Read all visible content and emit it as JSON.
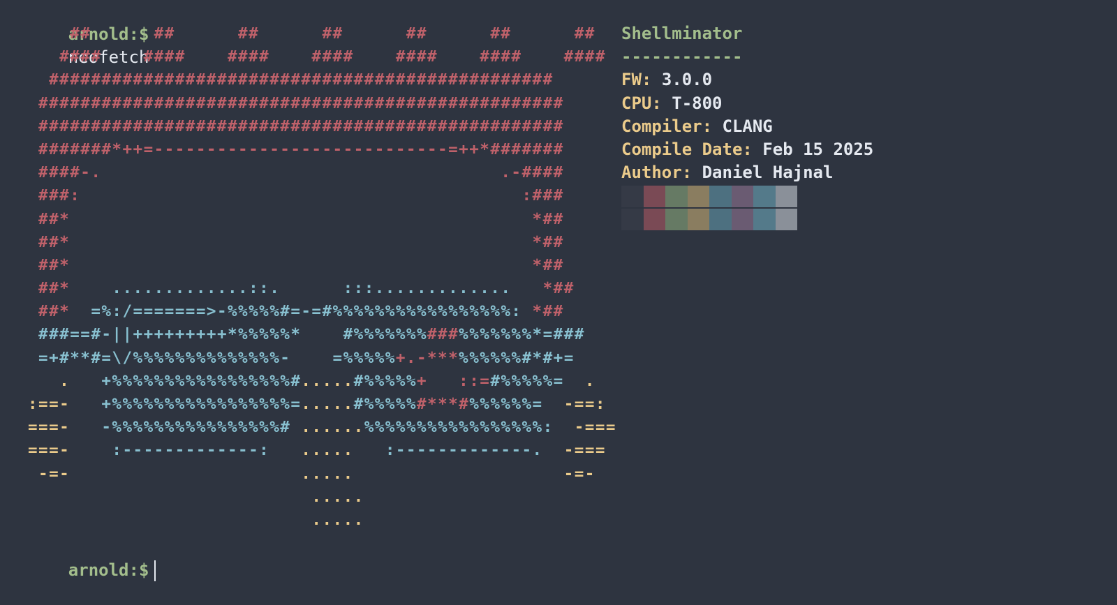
{
  "prompt": {
    "user": "arnold:$",
    "command": "neofetch",
    "next_user": "arnold:$"
  },
  "logo": {
    "lines": [
      [
        [
          "r",
          "    ##      ##      ##      ##      ##      ##      ##"
        ]
      ],
      [
        [
          "r",
          "   ####    ####    ####    ####    ####    ####    ####"
        ]
      ],
      [
        [
          "r",
          "  ################################################"
        ]
      ],
      [
        [
          "r",
          " ##################################################"
        ]
      ],
      [
        [
          "r",
          " ##################################################"
        ]
      ],
      [
        [
          "r",
          " #######*++=----------------------------=++*#######"
        ]
      ],
      [
        [
          "r",
          " ####-.                                      .-####"
        ]
      ],
      [
        [
          "r",
          " ###:                                          :###"
        ]
      ],
      [
        [
          "r",
          " ##*                                            *##"
        ]
      ],
      [
        [
          "r",
          " ##*                                            *##"
        ]
      ],
      [
        [
          "r",
          " ##*                                            *##"
        ]
      ],
      [
        [
          "r",
          " ##*"
        ],
        [
          "b",
          "    .............::.      :::............."
        ],
        [
          "r",
          "   *##"
        ]
      ],
      [
        [
          "r",
          " ##*"
        ],
        [
          "b",
          "  =%:/=======>-%%%%%#=-=#%%%%%%%%%%%%%%%%%: "
        ],
        [
          "r",
          "*##"
        ]
      ],
      [
        [
          "b",
          " ###==#-||+++++++++*%%%%%*    #%%%%%%%"
        ],
        [
          "r",
          "###"
        ],
        [
          "b",
          "%%%%%%%*=###"
        ]
      ],
      [
        [
          "b",
          " =+#**#=\\/%%%%%%%%%%%%%%-    =%%%%%"
        ],
        [
          "r",
          "+.-***"
        ],
        [
          "b",
          "%%%%%%#*#+="
        ]
      ],
      [
        [
          "y",
          "   .   "
        ],
        [
          "b",
          "+%%%%%%%%%%%%%%%%%#"
        ],
        [
          "y",
          "....."
        ],
        [
          "b",
          "#%%%%%"
        ],
        [
          "r",
          "+   ::="
        ],
        [
          "b",
          "#%%%%%="
        ],
        [
          "y",
          "  ."
        ]
      ],
      [
        [
          "y",
          ":==-   "
        ],
        [
          "b",
          "+%%%%%%%%%%%%%%%%%="
        ],
        [
          "y",
          "....."
        ],
        [
          "b",
          "#%%%%%"
        ],
        [
          "r",
          "#***#"
        ],
        [
          "b",
          "%%%%%%="
        ],
        [
          "y",
          "  -==:"
        ]
      ],
      [
        [
          "y",
          "===-   "
        ],
        [
          "b",
          "-%%%%%%%%%%%%%%%%#"
        ],
        [
          "y",
          " ......"
        ],
        [
          "b",
          "%%%%%%%%%%%%%%%%%: "
        ],
        [
          "y",
          " -==="
        ]
      ],
      [
        [
          "y",
          "===-    "
        ],
        [
          "b",
          ":-------------:"
        ],
        [
          "y",
          "   .....   "
        ],
        [
          "b",
          ":-------------."
        ],
        [
          "y",
          "  -==="
        ]
      ],
      [
        [
          "y",
          " -=-                      .....                    -=-"
        ]
      ],
      [
        [
          "y",
          "                           ....."
        ]
      ],
      [
        [
          "y",
          "                           ....."
        ]
      ]
    ]
  },
  "info": {
    "title": "Shellminator",
    "underline": "------------",
    "rows": [
      {
        "key": "FW:",
        "value": "3.0.0"
      },
      {
        "key": "CPU:",
        "value": "T-800"
      },
      {
        "key": "Compiler:",
        "value": "CLANG"
      },
      {
        "key": "Compile Date:",
        "value": "Feb 15 2025"
      },
      {
        "key": "Author:",
        "value": "Daniel Hajnal"
      }
    ]
  },
  "palette": {
    "row1": [
      "#353a46",
      "#7a4a55",
      "#667a64",
      "#8a7d60",
      "#4d7080",
      "#6a5b72",
      "#547a8a",
      "#8a9099"
    ],
    "row2": [
      "#353a46",
      "#7a4a55",
      "#667a64",
      "#8a7d60",
      "#4d7080",
      "#6a5b72",
      "#547a8a",
      "#8a9099"
    ]
  }
}
